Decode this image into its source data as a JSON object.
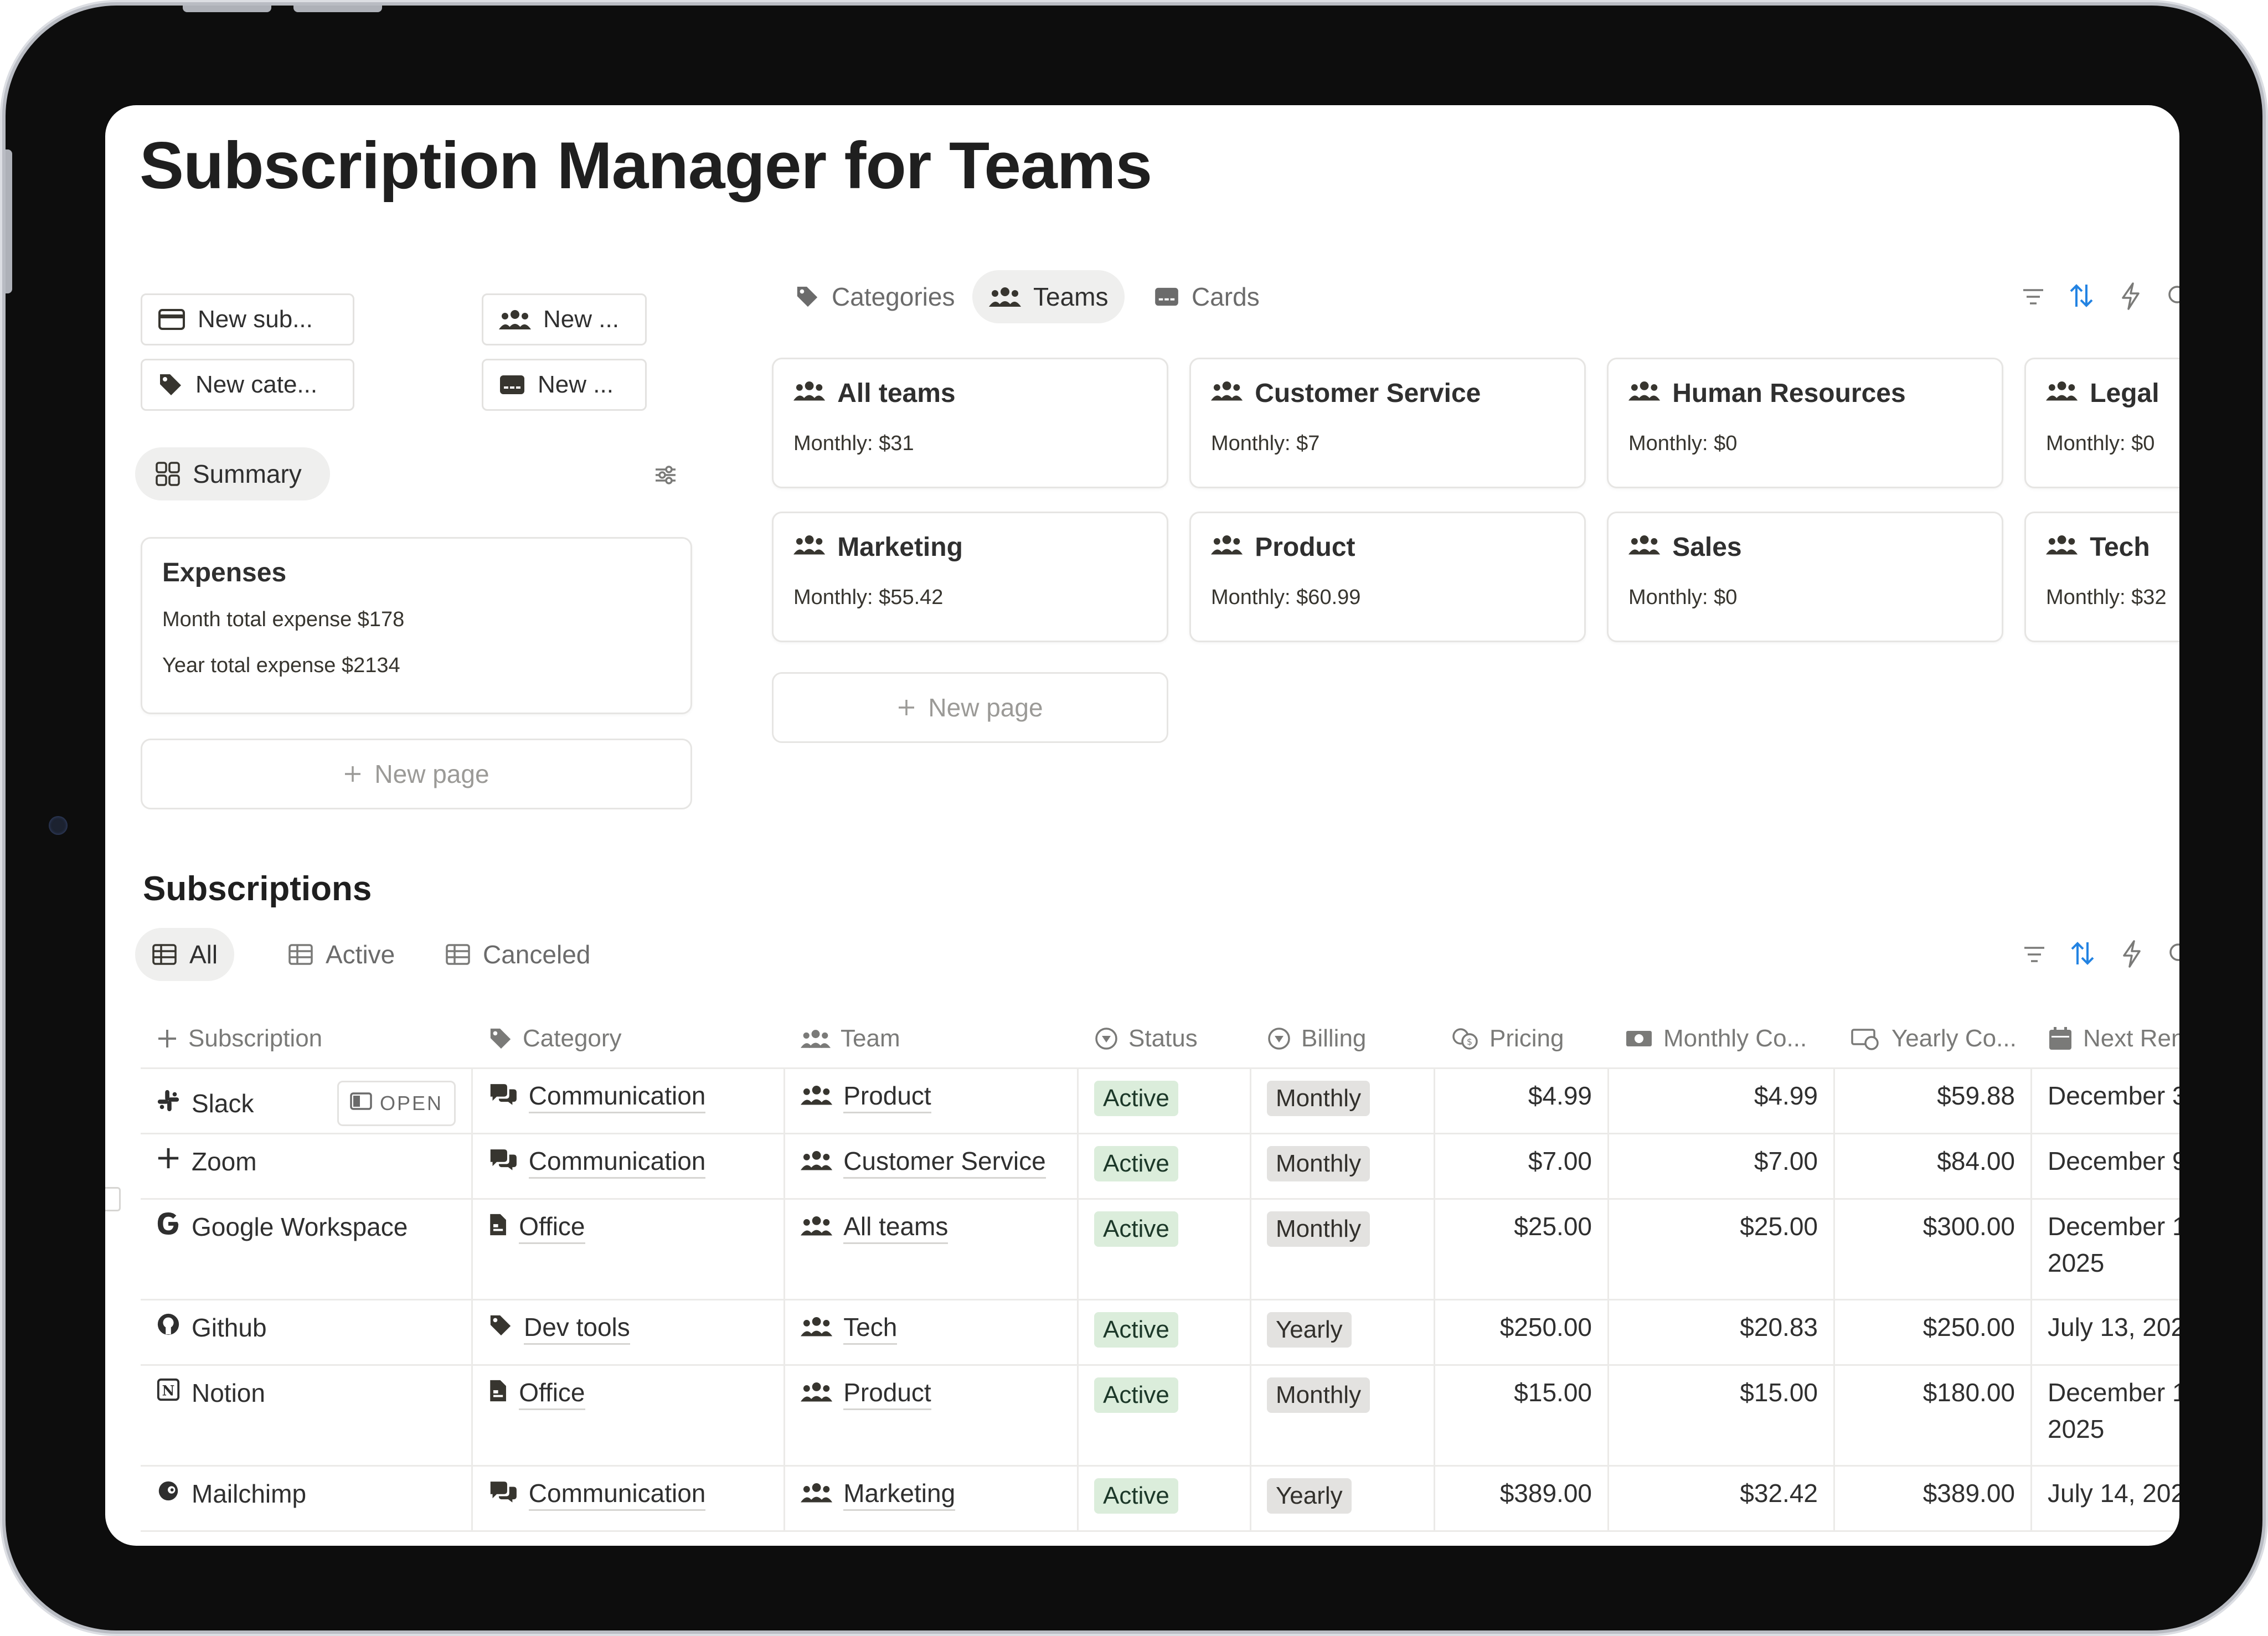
{
  "page": {
    "title": "Subscription Manager for Teams"
  },
  "quick_actions": [
    {
      "label": "New sub...",
      "icon": "credit-card-icon"
    },
    {
      "label": "New ...",
      "icon": "people-icon"
    },
    {
      "label": "New cate...",
      "icon": "tag-icon"
    },
    {
      "label": "New ...",
      "icon": "card-icon"
    }
  ],
  "summary": {
    "view_label": "Summary",
    "card_title": "Expenses",
    "month_total": "Month total expense $178",
    "year_total": "Year total expense $2134",
    "new_page": "New page"
  },
  "teams_view": {
    "tabs": [
      {
        "label": "Categories",
        "icon": "tag-icon",
        "active": false
      },
      {
        "label": "Teams",
        "icon": "people-icon",
        "active": true
      },
      {
        "label": "Cards",
        "icon": "card-icon",
        "active": false
      }
    ],
    "cards": [
      {
        "name": "All teams",
        "amount": "Monthly: $31"
      },
      {
        "name": "Customer Service",
        "amount": "Monthly: $7"
      },
      {
        "name": "Human Resources",
        "amount": "Monthly: $0"
      },
      {
        "name": "Legal",
        "amount": "Monthly: $0"
      },
      {
        "name": "Marketing",
        "amount": "Monthly: $55.42"
      },
      {
        "name": "Product",
        "amount": "Monthly: $60.99"
      },
      {
        "name": "Sales",
        "amount": "Monthly: $0"
      },
      {
        "name": "Tech",
        "amount": "Monthly: $32"
      }
    ],
    "new_page": "New page"
  },
  "subscriptions": {
    "heading": "Subscriptions",
    "views": [
      {
        "label": "All",
        "active": true
      },
      {
        "label": "Active",
        "active": false
      },
      {
        "label": "Canceled",
        "active": false
      }
    ],
    "columns": [
      "Subscription",
      "Category",
      "Team",
      "Status",
      "Billing",
      "Pricing",
      "Monthly Co...",
      "Yearly Co...",
      "Next Ren"
    ],
    "open_label": "OPEN",
    "rows": [
      {
        "name": "Slack",
        "icon": "slack-icon",
        "category": "Communication",
        "category_icon": "chat-icon",
        "team": "Product",
        "status": "Active",
        "billing": "Monthly",
        "pricing": "$4.99",
        "monthly": "$4.99",
        "yearly": "$59.88",
        "next_line1": "December 3",
        "next_line2": ""
      },
      {
        "name": "Zoom",
        "icon": "plus-icon",
        "category": "Communication",
        "category_icon": "chat-icon",
        "team": "Customer Service",
        "status": "Active",
        "billing": "Monthly",
        "pricing": "$7.00",
        "monthly": "$7.00",
        "yearly": "$84.00",
        "next_line1": "December 9",
        "next_line2": ""
      },
      {
        "name": "Google Workspace",
        "icon": "google-icon",
        "category": "Office",
        "category_icon": "document-icon",
        "team": "All teams",
        "status": "Active",
        "billing": "Monthly",
        "pricing": "$25.00",
        "monthly": "$25.00",
        "yearly": "$300.00",
        "next_line1": "December 1",
        "next_line2": "2025"
      },
      {
        "name": "Github",
        "icon": "github-icon",
        "category": "Dev tools",
        "category_icon": "tag-icon",
        "team": "Tech",
        "status": "Active",
        "billing": "Yearly",
        "pricing": "$250.00",
        "monthly": "$20.83",
        "yearly": "$250.00",
        "next_line1": "July 13, 202",
        "next_line2": ""
      },
      {
        "name": "Notion",
        "icon": "notion-icon",
        "category": "Office",
        "category_icon": "document-icon",
        "team": "Product",
        "status": "Active",
        "billing": "Monthly",
        "pricing": "$15.00",
        "monthly": "$15.00",
        "yearly": "$180.00",
        "next_line1": "December 1",
        "next_line2": "2025"
      },
      {
        "name": "Mailchimp",
        "icon": "mailchimp-icon",
        "category": "Communication",
        "category_icon": "chat-icon",
        "team": "Marketing",
        "status": "Active",
        "billing": "Yearly",
        "pricing": "$389.00",
        "monthly": "$32.42",
        "yearly": "$389.00",
        "next_line1": "July 14, 202",
        "next_line2": ""
      }
    ]
  },
  "colors": {
    "accent": "#2383e2",
    "active_tag_bg": "#dbeddb",
    "gray_tag_bg": "#e3e2e0",
    "border": "#e6e5e3"
  }
}
